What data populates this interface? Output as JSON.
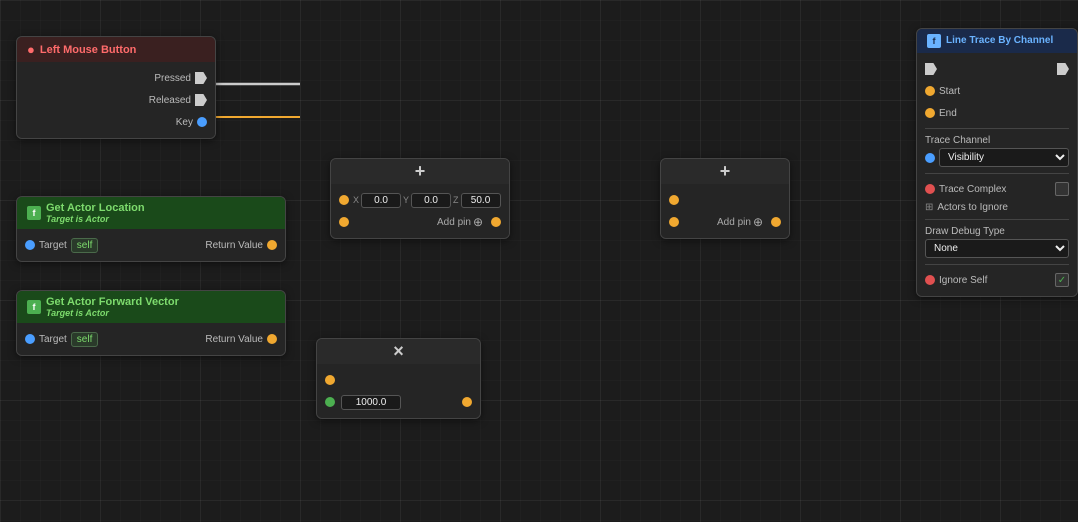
{
  "nodes": {
    "inputEvent": {
      "title": "Left Mouse Button",
      "pressed": "Pressed",
      "released": "Released",
      "key": "Key"
    },
    "getActorLocation": {
      "title": "Get Actor Location",
      "subtitle": "Target is Actor",
      "target": "Target",
      "self": "self",
      "returnValue": "Return Value"
    },
    "getActorForwardVector": {
      "title": "Get Actor Forward Vector",
      "subtitle": "Target is Actor",
      "target": "Target",
      "self": "self",
      "returnValue": "Return Value"
    },
    "addVector": {
      "title": "+",
      "xVal": "0.0",
      "yVal": "0.0",
      "zVal": "50.0",
      "addPin": "Add pin"
    },
    "addPinNode": {
      "title": "+",
      "addPin": "Add pin"
    },
    "multiply": {
      "title": "×",
      "value": "1000.0"
    },
    "lineTrace": {
      "title": "Line Trace By Channel",
      "start": "Start",
      "end": "End",
      "traceChannel": "Trace Channel",
      "traceChannelValue": "Visibility",
      "traceComplex": "Trace Complex",
      "actorsToIgnore": "Actors to Ignore",
      "drawDebugType": "Draw Debug Type",
      "drawDebugValue": "None",
      "ignoreSelf": "Ignore Self"
    }
  }
}
